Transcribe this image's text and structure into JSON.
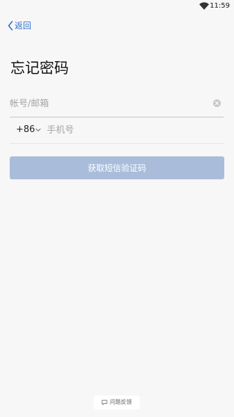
{
  "status_bar": {
    "time": "11:59",
    "wifi_icon": "wifi-icon"
  },
  "header": {
    "back_label": "返回",
    "back_icon": "chevron-left-icon"
  },
  "title": "忘记密码",
  "account_field": {
    "placeholder": "帐号/邮箱",
    "value": "",
    "clear_icon": "clear-circle-icon"
  },
  "phone_field": {
    "country_code": "+86",
    "chevron_icon": "chevron-down-icon",
    "placeholder": "手机号",
    "value": ""
  },
  "sms_button": {
    "label": "获取短信验证码",
    "enabled": false
  },
  "feedback": {
    "label": "问题反馈",
    "icon": "chat-bubble-icon"
  },
  "colors": {
    "accent": "#2f6fd0",
    "button_disabled": "#a9bddb",
    "background": "#f7f7f7"
  }
}
